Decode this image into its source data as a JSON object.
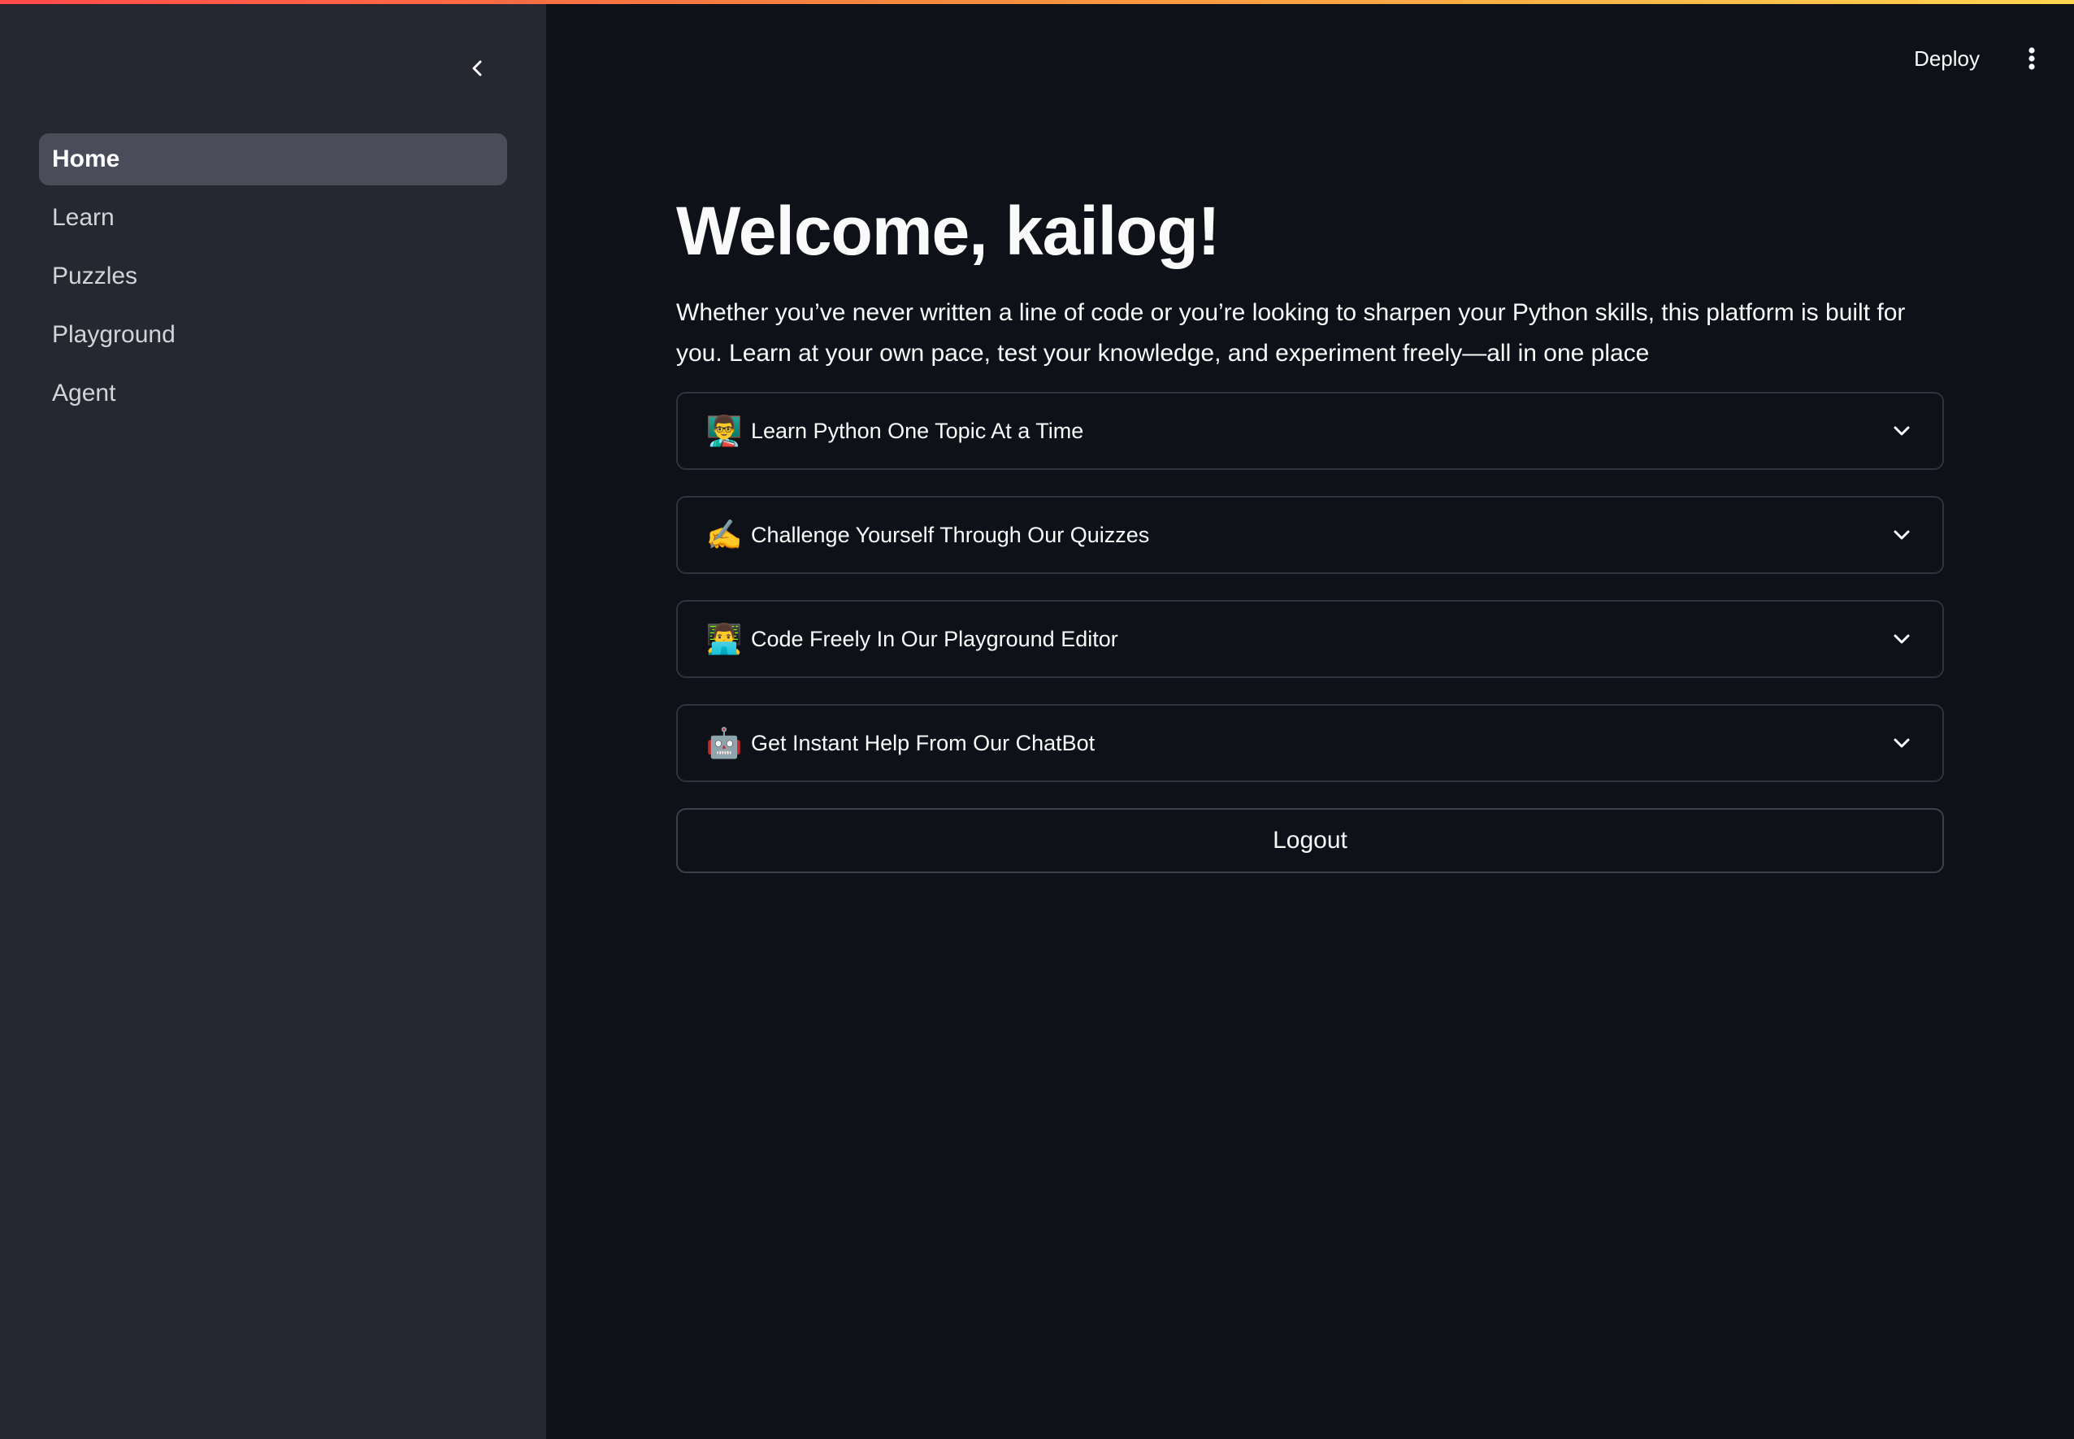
{
  "sidebar": {
    "collapse_icon": "chevron-left-icon",
    "items": [
      {
        "label": "Home",
        "active": true
      },
      {
        "label": "Learn",
        "active": false
      },
      {
        "label": "Puzzles",
        "active": false
      },
      {
        "label": "Playground",
        "active": false
      },
      {
        "label": "Agent",
        "active": false
      }
    ]
  },
  "header": {
    "deploy_label": "Deploy",
    "menu_icon": "vertical-ellipsis-icon"
  },
  "main": {
    "title": "Welcome, kailog!",
    "intro": "Whether you’ve never written a line of code or you’re looking to sharpen your Python skills, this platform is built for you. Learn at your own pace, test your knowledge, and experiment freely—all in one place",
    "expanders": [
      {
        "emoji": "👨‍🏫",
        "label": "Learn Python One Topic At a Time",
        "icon": "teacher-icon"
      },
      {
        "emoji": "✍️",
        "label": "Challenge Yourself Through Our Quizzes",
        "icon": "writing-hand-icon"
      },
      {
        "emoji": "👨‍💻",
        "label": "Code Freely In Our Playground Editor",
        "icon": "technologist-icon"
      },
      {
        "emoji": "🤖",
        "label": "Get Instant Help From Our ChatBot",
        "icon": "robot-icon"
      }
    ],
    "logout_label": "Logout"
  },
  "colors": {
    "sidebar_bg": "#262730",
    "main_bg": "#0e1117",
    "active_item_bg": "#4a4c59",
    "border": "#31333f",
    "accent_gradient_start": "#ff4b4b",
    "accent_gradient_end": "#ffd54f"
  }
}
